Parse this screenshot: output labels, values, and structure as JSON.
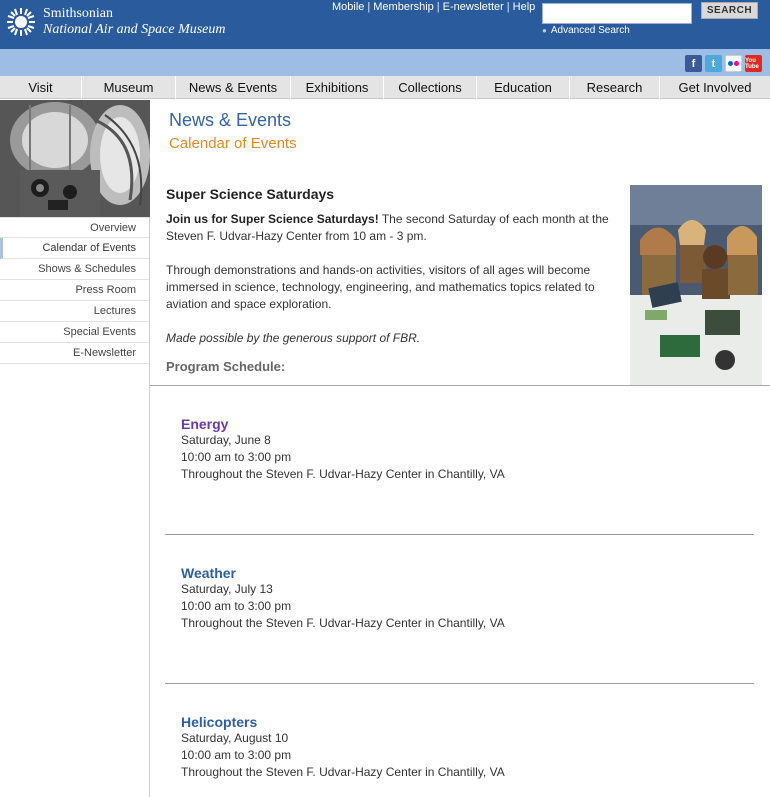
{
  "header": {
    "logo_line1": "Smithsonian",
    "logo_line2": "National Air and Space Museum",
    "top_links": [
      "Mobile",
      "Membership",
      "E-newsletter",
      "Help"
    ],
    "search_button": "SEARCH",
    "search_value": "",
    "advanced_search": "Advanced Search"
  },
  "social": {
    "facebook": "f",
    "twitter": "t",
    "youtube": "You Tube"
  },
  "nav": [
    "Visit",
    "Museum",
    "News & Events",
    "Exhibitions",
    "Collections",
    "Education",
    "Research",
    "Get Involved"
  ],
  "sidebar": {
    "items": [
      "Overview",
      "Calendar of Events",
      "Shows & Schedules",
      "Press Room",
      "Lectures",
      "Special Events",
      "E-Newsletter"
    ]
  },
  "main": {
    "section_title": "News & Events",
    "sub_title": "Calendar of Events",
    "event_heading": "Super Science Saturdays",
    "intro_bold": "Join us for Super Science Saturdays!",
    "intro_rest": " The second Saturday of each month at the Steven F. Udvar-Hazy Center from 10 am - 3 pm.",
    "para2": "Through demonstrations and hands-on activities, visitors of all ages will become immersed in science, technology, engineering, and mathematics topics related to aviation and space exploration.",
    "sponsor": "Made possible by the generous support of FBR.",
    "program_label": "Program Schedule:"
  },
  "programs": [
    {
      "name": "Energy",
      "color": "#6b3aa6",
      "date": "Saturday, June 8",
      "time": "10:00 am to 3:00 pm",
      "location": "Throughout the Steven F. Udvar-Hazy Center in Chantilly, VA"
    },
    {
      "name": "Weather",
      "color": "#2e5fa3",
      "date": "Saturday, July 13",
      "time": "10:00 am to 3:00 pm",
      "location": "Throughout the Steven F. Udvar-Hazy Center in Chantilly, VA"
    },
    {
      "name": "Helicopters",
      "color": "#2e5fa3",
      "date": "Saturday, August 10",
      "time": "10:00 am to 3:00 pm",
      "location": "Throughout the Steven F. Udvar-Hazy Center in Chantilly, VA"
    }
  ],
  "colors": {
    "header_blue": "#2a5b9c",
    "social_bar": "#9ebde5",
    "title_blue": "#3562a8",
    "subtitle_orange": "#e08a1d"
  }
}
